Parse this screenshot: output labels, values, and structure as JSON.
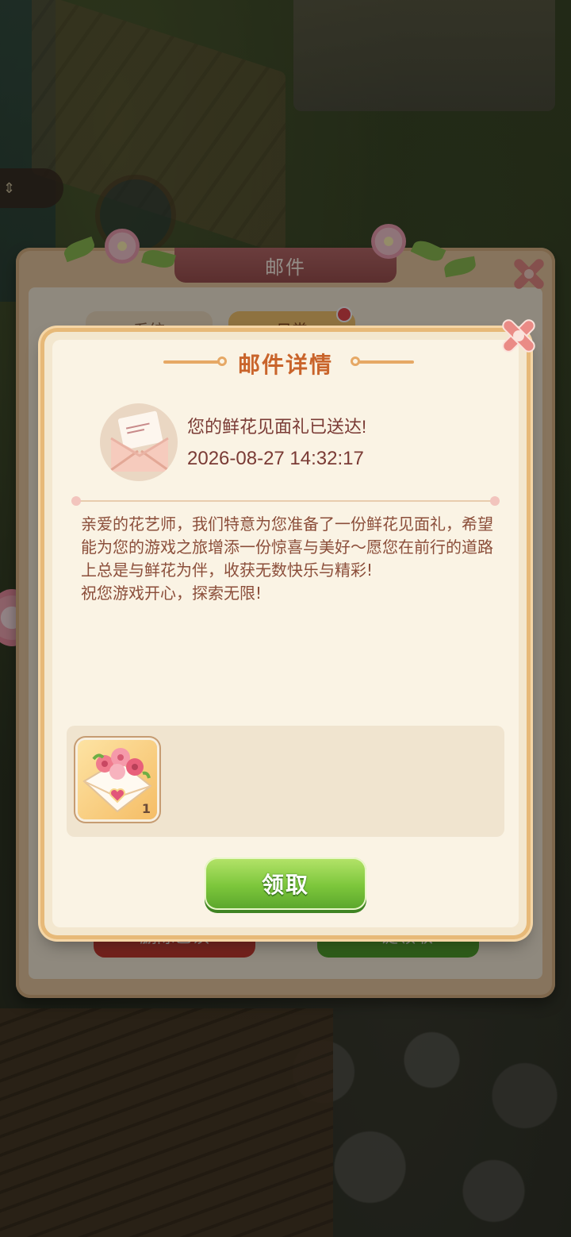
{
  "background_panel": {
    "title": "邮件",
    "tabs": [
      {
        "label": "系统"
      },
      {
        "label": "日常",
        "has_badge": true
      }
    ],
    "buttons": {
      "delete_read": "删除已读",
      "claim_all": "一键领取"
    }
  },
  "detail": {
    "title": "邮件详情",
    "subject": "您的鲜花见面礼已送达!",
    "timestamp": "2026-08-27 14:32:17",
    "body": [
      "亲爱的花艺师，我们特意为您准备了一份鲜花见面礼，希望能为您的游戏之旅增添一份惊喜与美好～愿您在前行的道路上总是与鲜花为伴，收获无数快乐与精彩!",
      "祝您游戏开心，探索无限!"
    ],
    "rewards": [
      {
        "icon": "flower-gift-envelope-icon",
        "count": "1"
      }
    ],
    "claim_label": "领取"
  },
  "colors": {
    "title_orange": "#c9642b",
    "text_brown": "#7a3b35",
    "claim_green": "#7cc63b",
    "close_pink": "#e57c7c"
  }
}
